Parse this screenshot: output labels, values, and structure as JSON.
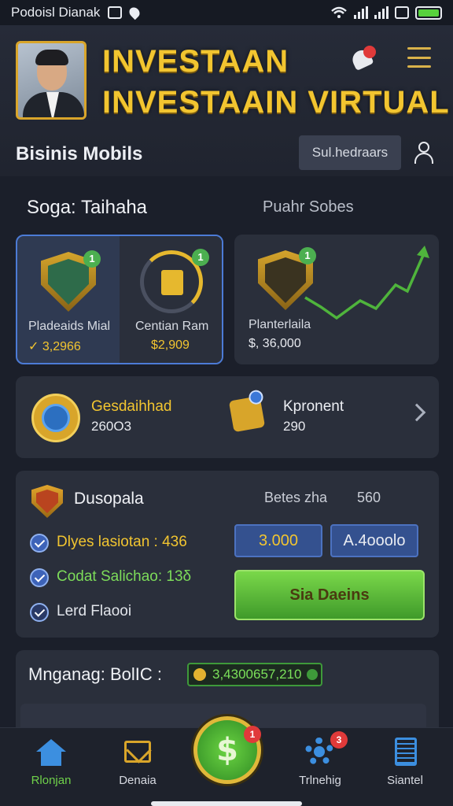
{
  "status_bar": {
    "left_text": "Podoisl Dianak"
  },
  "header": {
    "title_line1": "INVESTAAN",
    "title_line2": "INVESTAAIN VIRTUAL",
    "subtitle": "Bisinis Mobils",
    "search_placeholder": "Sul.hedraars",
    "notif_count": ""
  },
  "section": {
    "title": "Soga: Taihaha",
    "subtitle": "Puahr Sobes"
  },
  "card_a": {
    "item1_label": "Pladeaids Mial",
    "item1_value": "✓ 3,2966",
    "item1_badge": "1",
    "item2_label": "Centian Ram",
    "item2_value": "$2,909",
    "item2_badge": "1"
  },
  "card_b": {
    "label": "Planterlaila",
    "value": "$, 36,000",
    "badge": "1"
  },
  "card_c": {
    "item1_label": "Gesdaihhad",
    "item1_value": "260O3",
    "item2_label": "Kpronent",
    "item2_value": "290"
  },
  "card_d": {
    "title": "Dusopala",
    "right_label": "Betes zha",
    "right_value": "560",
    "list": [
      {
        "text": "Dlyes lasiotan : 436"
      },
      {
        "text": "Codat Salichao: 13δ"
      },
      {
        "text": "Lerd Flaooi"
      }
    ],
    "btn1_label": "3.000",
    "btn2_label": "A.4ooolo",
    "cta_label": "Sia Daeins"
  },
  "card_e": {
    "title": "Mnganag: BolIC :",
    "balance": "3,4300657,210"
  },
  "bottom_nav": {
    "items": [
      {
        "label": "Rlonjan"
      },
      {
        "label": "Denaia"
      },
      {
        "label": "Trlnehig",
        "badge": "3"
      },
      {
        "label": "Siantel"
      }
    ],
    "center_badge": "1"
  },
  "colors": {
    "background": "#1b1f2a",
    "card": "#2a2f3b",
    "gold": "#f2c530",
    "accent_blue": "#3c8fe0",
    "green": "#57d13d",
    "badge_red": "#e03a3a"
  }
}
